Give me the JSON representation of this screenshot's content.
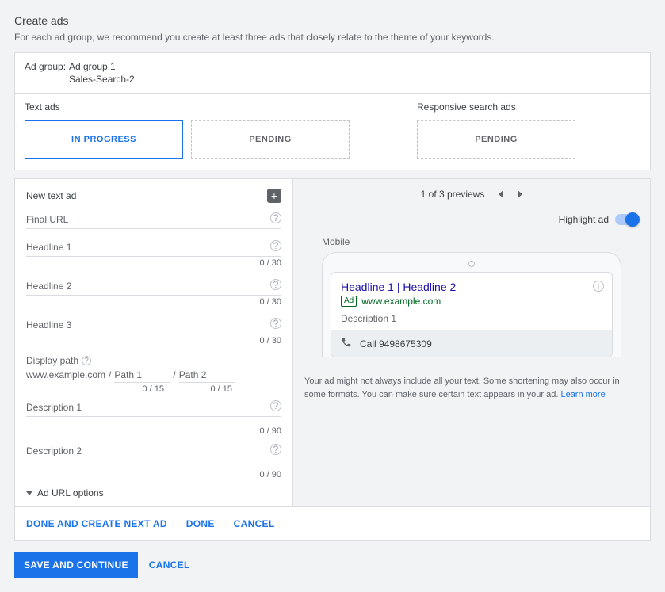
{
  "page": {
    "title": "Create ads",
    "subtitle": "For each ad group, we recommend you create at least three ads that closely relate to the theme of your keywords."
  },
  "adgroup": {
    "label": "Ad group:",
    "name": "Ad group 1",
    "sub": "Sales-Search-2"
  },
  "sections": {
    "text_ads": "Text ads",
    "responsive": "Responsive search ads",
    "tiles": {
      "in_progress": "IN PROGRESS",
      "pending": "PENDING"
    }
  },
  "editor": {
    "title": "New text ad",
    "fields": {
      "final_url": "Final URL",
      "headline1": "Headline 1",
      "headline2": "Headline 2",
      "headline3": "Headline 3",
      "desc1": "Description 1",
      "desc2": "Description 2",
      "display_path": "Display path",
      "path_domain": "www.example.com",
      "path1": "Path 1",
      "path2": "Path 2",
      "ad_url_options": "Ad URL options"
    },
    "counters": {
      "h30": "0 / 30",
      "p15": "0 / 15",
      "d90": "0 / 90"
    },
    "actions": {
      "done_next": "DONE AND CREATE NEXT AD",
      "done": "DONE",
      "cancel": "CANCEL"
    }
  },
  "preview": {
    "pager": "1 of 3 previews",
    "highlight": "Highlight ad",
    "mobile_label": "Mobile",
    "ad": {
      "title": "Headline 1 | Headline 2",
      "badge": "Ad",
      "url": "www.example.com",
      "desc": "Description 1",
      "call": "Call 9498675309"
    },
    "disclaimer": "Your ad might not always include all your text. Some shortening may also occur in some formats. You can make sure certain text appears in your ad. ",
    "learn_more": "Learn more"
  },
  "footer": {
    "save": "SAVE AND CONTINUE",
    "cancel": "CANCEL"
  }
}
